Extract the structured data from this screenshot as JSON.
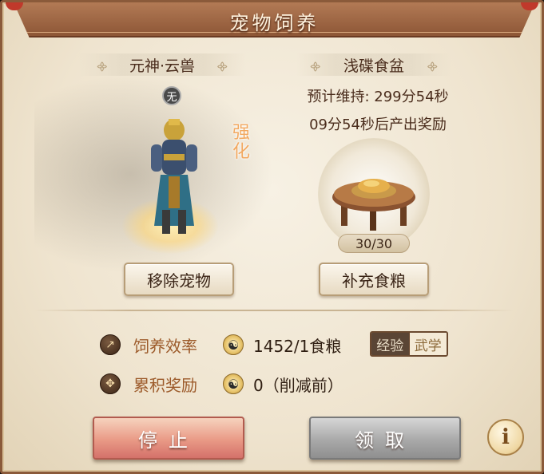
{
  "window": {
    "title": "宠物饲养"
  },
  "pet": {
    "name": "元神·云兽",
    "badge": "无",
    "tag": "强化",
    "remove_button": "移除宠物"
  },
  "food": {
    "name": "浅碟食盆",
    "duration_line": "预计维持: 299分54秒",
    "reward_line": "09分54秒后产出奖励",
    "count": "30/30",
    "refill_button": "补充食粮"
  },
  "stats": {
    "efficiency_label": "饲养效率",
    "efficiency_value": "1452/1食粮",
    "reward_label": "累积奖励",
    "reward_value": "0（削减前）",
    "toggle": {
      "exp": "经验",
      "martial": "武学",
      "selected": "经验"
    }
  },
  "actions": {
    "stop": "停止",
    "claim": "领取",
    "info": "i"
  },
  "colors": {
    "frame": "#8a5a3a",
    "stat_label": "#9c5a2a",
    "stop_button": "#e99a86",
    "claim_button": "#a9a9a9"
  }
}
